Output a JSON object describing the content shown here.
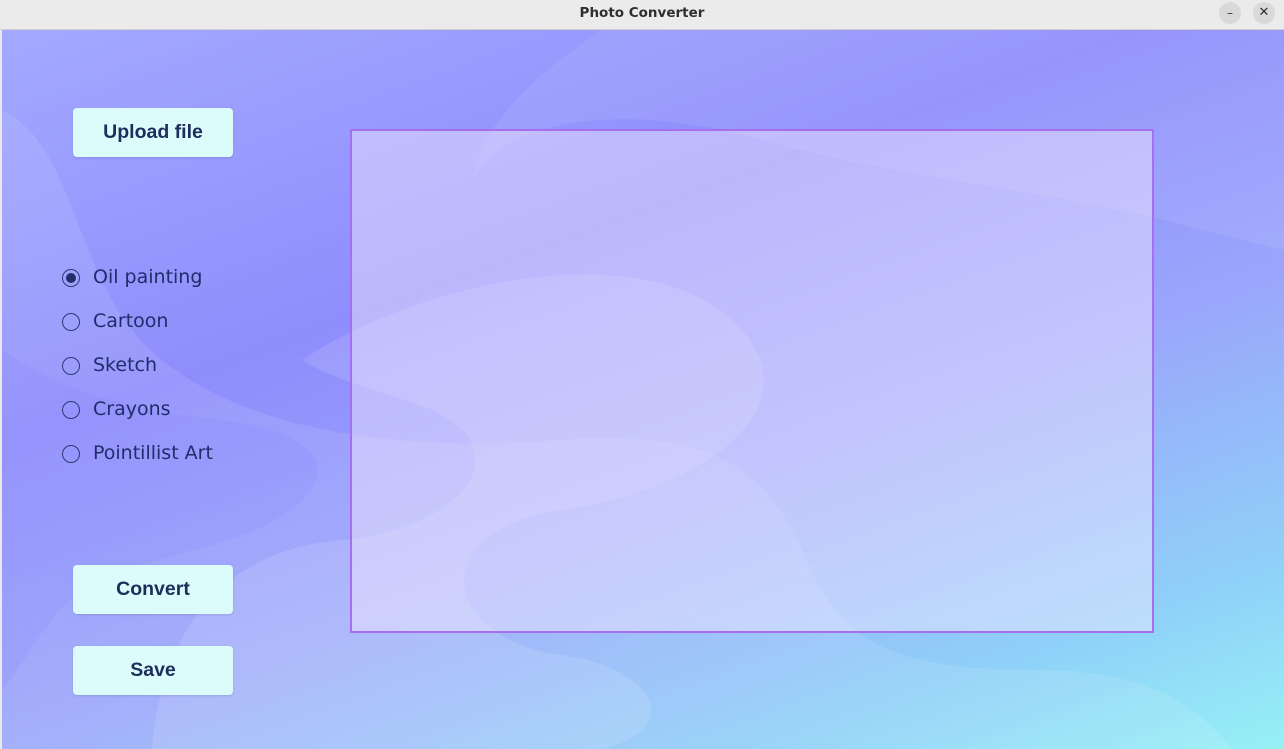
{
  "window": {
    "title": "Photo Converter",
    "minimize_icon": "minimize-icon",
    "close_icon": "close-icon",
    "minimize_glyph": "–",
    "close_glyph": "✕"
  },
  "buttons": {
    "upload_label": "Upload file",
    "convert_label": "Convert",
    "save_label": "Save"
  },
  "styles": {
    "options": [
      {
        "label": "Oil painting",
        "checked": true
      },
      {
        "label": "Cartoon",
        "checked": false
      },
      {
        "label": "Sketch",
        "checked": false
      },
      {
        "label": "Crayons",
        "checked": false
      },
      {
        "label": "Pointillist Art",
        "checked": false
      }
    ]
  },
  "colors": {
    "button_bg": "#dcfcfb",
    "button_text": "#1d2d5c",
    "preview_border": "#a66ef0",
    "radio_text": "#1f2d6b"
  }
}
